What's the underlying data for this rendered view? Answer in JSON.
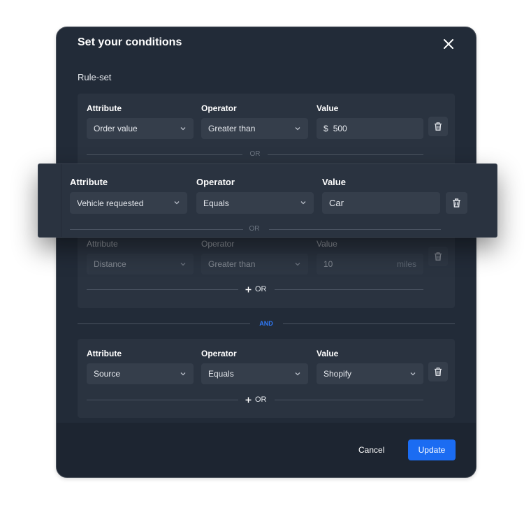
{
  "modal": {
    "title": "Set your conditions",
    "subtitle": "Rule-set",
    "cancel_label": "Cancel",
    "update_label": "Update",
    "accent_color": "#1b6cf2"
  },
  "labels": {
    "attribute": "Attribute",
    "operator": "Operator",
    "value": "Value"
  },
  "group1": {
    "rule1": {
      "attribute": "Order value",
      "operator": "Greater than",
      "value_prefix": "$",
      "value": "500"
    },
    "separator": "OR",
    "rule3": {
      "attribute": "Distance",
      "operator": "Greater than",
      "value": "10",
      "value_suffix": "miles"
    },
    "add_or": "OR"
  },
  "and_label": "AND",
  "group2": {
    "rule1": {
      "attribute": "Source",
      "operator": "Equals",
      "value": "Shopify"
    },
    "add_or": "OR"
  },
  "floating_rule": {
    "attribute": "Vehicle requested",
    "operator": "Equals",
    "value": "Car",
    "separator": "OR"
  }
}
